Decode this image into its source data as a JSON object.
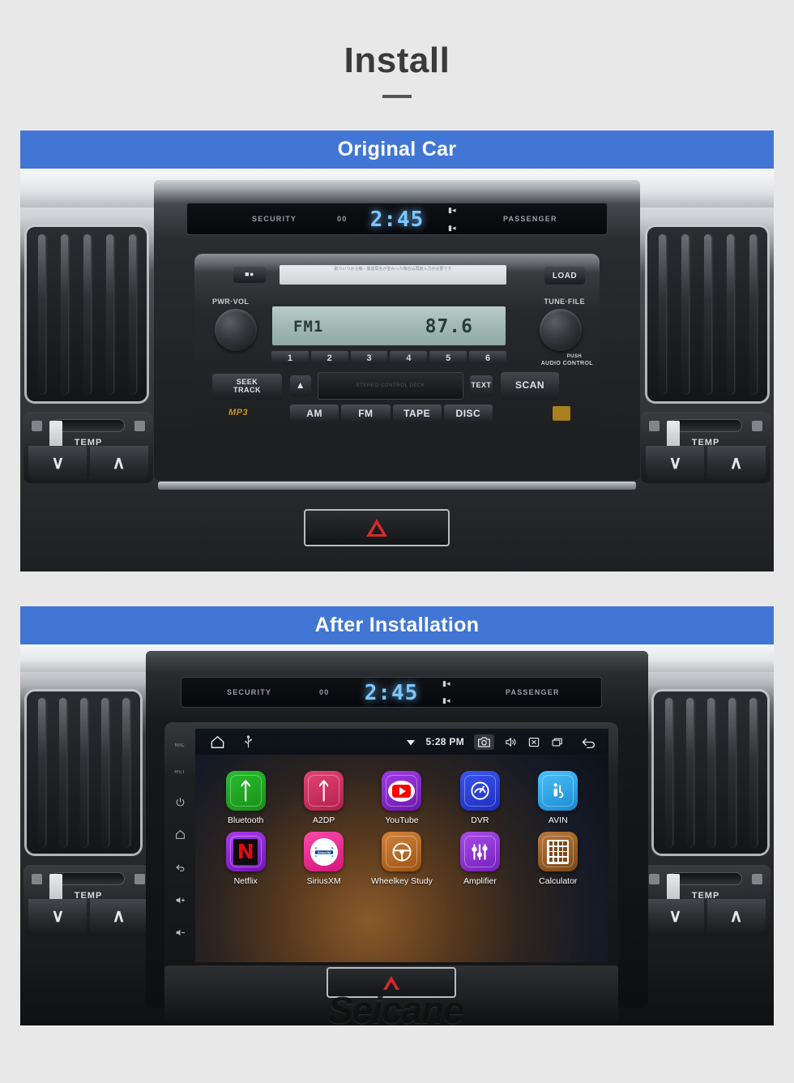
{
  "header": {
    "title": "Install"
  },
  "sections": [
    {
      "id": "original",
      "banner_label": "Original Car",
      "photo": {
        "info_display": {
          "security_label": "SECURITY",
          "door_label": "00",
          "clock": "2:45",
          "passenger_label": "PASSENGER"
        },
        "head_unit": {
          "cd_slot_text": "取りいつかえ機・放送局名が変わった場合は再度入力が必要です",
          "load_label": "LOAD",
          "left_knob_label": "PWR·VOL",
          "right_knob_label": "TUNE·FILE",
          "audio_control_label": "AUDIO CONTROL",
          "push_label": "PUSH",
          "lcd_band": "FM1",
          "lcd_frequency": "87.6",
          "presets": [
            "1",
            "2",
            "3",
            "4",
            "5",
            "6"
          ],
          "seek_label": "SEEK",
          "track_label": "TRACK",
          "text_button": "TEXT",
          "scan_button": "SCAN",
          "tape_door_text": "STEREO CONTROL DECK",
          "mp3_logo": "MP3",
          "bands": [
            "AM",
            "FM",
            "TAPE",
            "DISC"
          ]
        },
        "climate": {
          "temp_label": "TEMP",
          "down_glyph": "∨",
          "up_glyph": "∧"
        }
      }
    },
    {
      "id": "after",
      "banner_label": "After  Installation",
      "photo": {
        "info_display": {
          "security_label": "SECURITY",
          "door_label": "00",
          "clock": "2:45",
          "passenger_label": "PASSENGER"
        },
        "android": {
          "side_rail": [
            "MIC",
            "RST",
            "power-icon",
            "home-icon",
            "back-icon",
            "volume-up-icon",
            "volume-down-icon"
          ],
          "statusbar": {
            "time": "5:28 PM",
            "left_icons": [
              "home-icon",
              "usb-icon"
            ],
            "right_icons": [
              "wifi-icon",
              "screenshot-icon",
              "volume-icon",
              "close-icon",
              "recents-icon",
              "back-icon"
            ]
          },
          "apps": [
            {
              "label": "Bluetooth",
              "icon": "bluetooth-icon",
              "color": "#22a726",
              "color2": "#1a8a1d"
            },
            {
              "label": "A2DP",
              "icon": "a2dp-icon",
              "color": "#d6366b",
              "color2": "#b82553"
            },
            {
              "label": "YouTube",
              "icon": "youtube-icon",
              "color": "#8e2fd6",
              "color2": "#7320b8"
            },
            {
              "label": "DVR",
              "icon": "dvr-icon",
              "color": "#2d49e8",
              "color2": "#1f33c4"
            },
            {
              "label": "AVIN",
              "icon": "avin-icon",
              "color": "#36b4f5",
              "color2": "#1f93da"
            },
            {
              "label": "Netflix",
              "icon": "netflix-icon",
              "color": "#9b2be0",
              "color2": "#7a17bd"
            },
            {
              "label": "SiriusXM",
              "icon": "siriusxm-icon",
              "color": "#f5339b",
              "color2": "#d41b7e"
            },
            {
              "label": "Wheelkey Study",
              "icon": "steering-wheel-icon",
              "color": "#c7742a",
              "color2": "#a55a18"
            },
            {
              "label": "Amplifier",
              "icon": "equalizer-icon",
              "color": "#9b3ae0",
              "color2": "#7a22bd"
            },
            {
              "label": "Calculator",
              "icon": "calculator-icon",
              "color": "#a6682f",
              "color2": "#85501f"
            }
          ]
        },
        "climate": {
          "temp_label": "TEMP",
          "down_glyph": "∨",
          "up_glyph": "∧"
        },
        "watermark": "Seicane"
      }
    }
  ],
  "colors": {
    "banner_blue": "#4276d4",
    "page_background": "#e8e8e8",
    "title_text": "#3a3a3a",
    "clock_blue": "#7ec6ff",
    "hazard_red": "#d32b2b"
  }
}
